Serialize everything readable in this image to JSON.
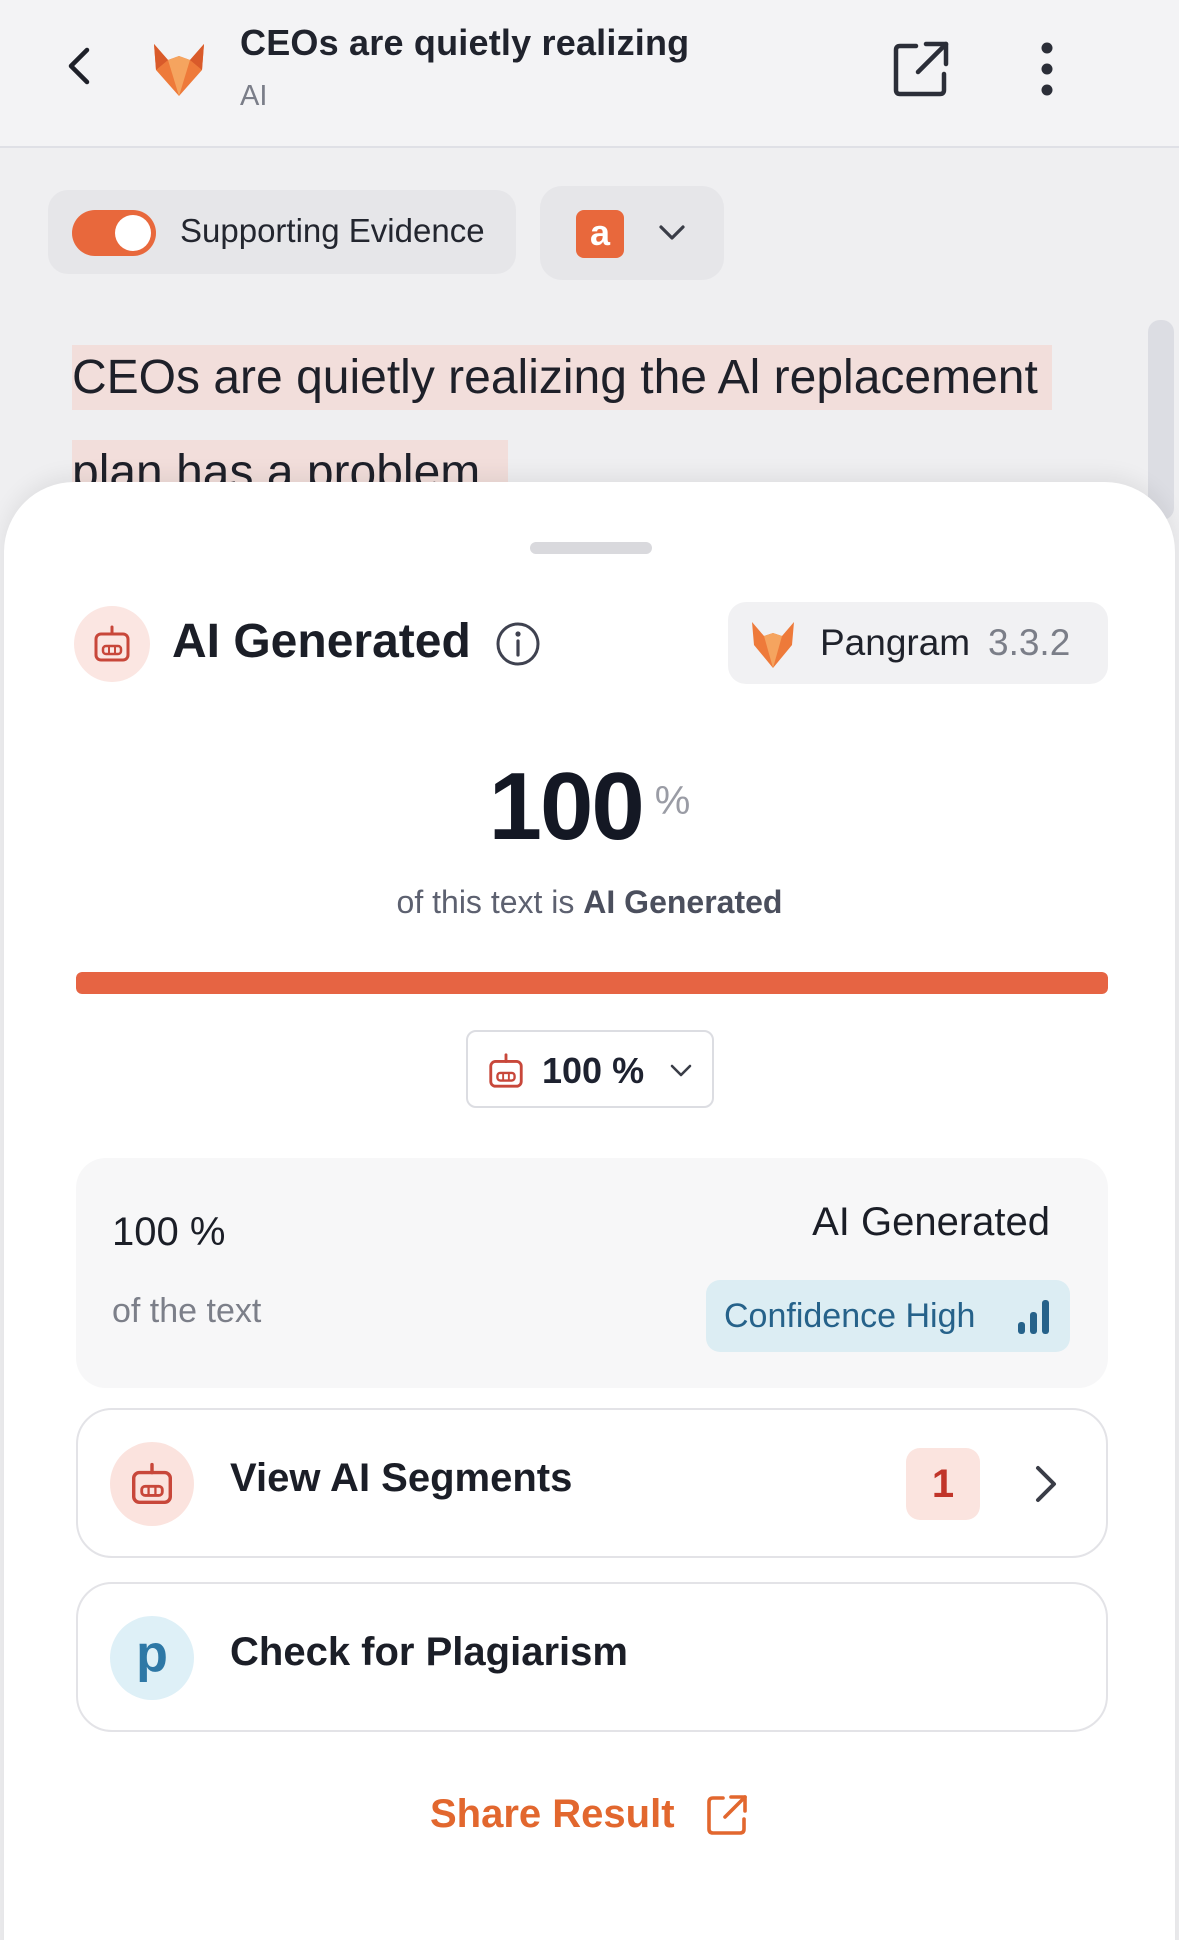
{
  "header": {
    "title": "CEOs are quietly realizing",
    "subtitle": "AI",
    "back_icon": "chevron-left-icon",
    "logo_icon": "fox-logo-icon",
    "open_icon": "external-link-icon",
    "more_icon": "more-vertical-icon"
  },
  "toolbar": {
    "evidence_toggle": {
      "label": "Supporting Evidence",
      "on": true
    },
    "model_badge": "a",
    "model_chevron_icon": "chevron-down-icon"
  },
  "document": {
    "lines": [
      "CEOs are quietly realizing the Al replacement",
      "plan has a problem."
    ]
  },
  "sheet": {
    "title": "AI Generated",
    "info_icon": "info-icon",
    "provider": {
      "name": "Pangram",
      "version": "3.3.2"
    },
    "score": {
      "value": "100",
      "unit": "%"
    },
    "caption": {
      "prefix": "of this text is",
      "emphasis": "AI Generated"
    },
    "progress_fraction": 1.0,
    "filter_dropdown": {
      "label": "100 %"
    },
    "summary": {
      "percent": "100 %",
      "caption": "of the text",
      "label": "AI Generated",
      "confidence": "Confidence High"
    },
    "segments": {
      "label": "View AI Segments",
      "count": "1"
    },
    "plagiarism": {
      "label": "Check for Plagiarism",
      "icon_letter": "p"
    },
    "share": {
      "label": "Share Result"
    }
  },
  "colors": {
    "accent_orange": "#e8683c",
    "progress_fill": "#e66443",
    "share_orange": "#e2672e",
    "confidence_bg": "#dcedf3",
    "confidence_text": "#26628a",
    "highlight_bg": "#f2dedb"
  }
}
